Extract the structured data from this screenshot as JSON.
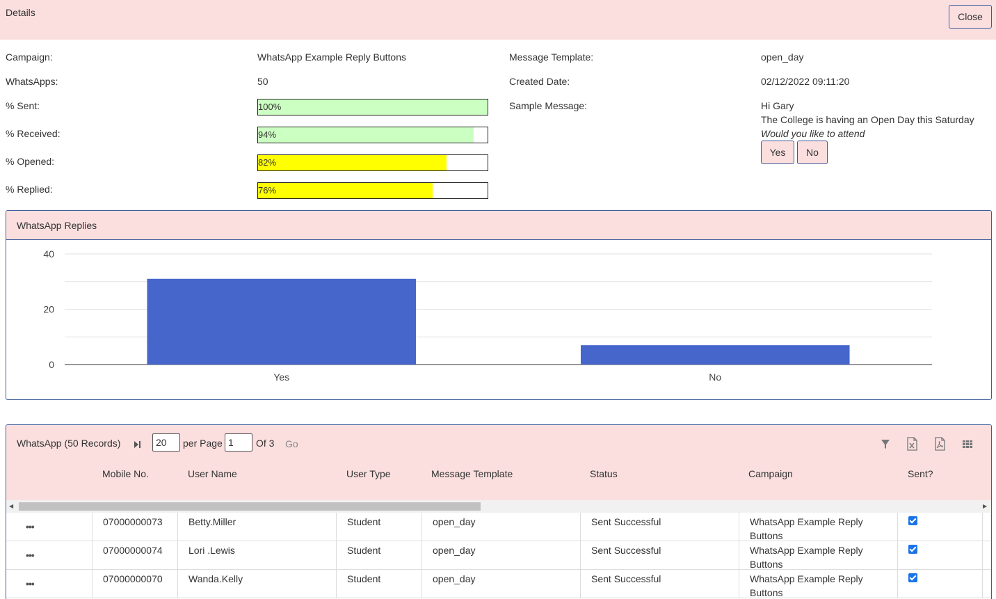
{
  "header": {
    "title": "Details",
    "close_label": "Close"
  },
  "details": {
    "campaign_label": "Campaign:",
    "campaign_value": "WhatsApp Example Reply Buttons",
    "whatsapps_label": "WhatsApps:",
    "whatsapps_value": "50",
    "template_label": "Message Template:",
    "template_value": "open_day",
    "created_label": "Created Date:",
    "created_value": "02/12/2022 09:11:20",
    "sample_label": "Sample Message:",
    "sample_lines": [
      "Hi Gary",
      "The College is having an Open Day this Saturday",
      "Would you like to attend"
    ],
    "sample_buttons": [
      "Yes",
      "No"
    ]
  },
  "progress": [
    {
      "label": "% Sent:",
      "text": "100%",
      "value": 100,
      "color": "#ccffc2"
    },
    {
      "label": "% Received:",
      "text": "94%",
      "value": 94,
      "color": "#ccffc2"
    },
    {
      "label": "% Opened:",
      "text": "82%",
      "value": 82,
      "color": "#ffff00"
    },
    {
      "label": "% Replied:",
      "text": "76%",
      "value": 76,
      "color": "#ffff00"
    }
  ],
  "replies_panel": {
    "title": "WhatsApp Replies"
  },
  "chart_data": {
    "type": "bar",
    "categories": [
      "Yes",
      "No"
    ],
    "values": [
      31,
      7
    ],
    "ylim": [
      0,
      40
    ],
    "yticks": [
      0,
      20,
      40
    ],
    "bar_color": "#4766cc",
    "grid": true
  },
  "grid": {
    "title": "WhatsApp (50 Records)",
    "per_page_value": "20",
    "per_page_label": "per Page",
    "page_value": "1",
    "of_label": "Of 3",
    "go_label": "Go",
    "columns": [
      "Mobile No.",
      "User Name",
      "User Type",
      "Message Template",
      "Status",
      "Campaign",
      "Sent?"
    ],
    "rows": [
      {
        "mobile": "07000000073",
        "user": "Betty.Miller",
        "type": "Student",
        "template": "open_day",
        "status": "Sent Successful",
        "campaign": "WhatsApp Example Reply Buttons",
        "sent": true
      },
      {
        "mobile": "07000000074",
        "user": "Lori .Lewis",
        "type": "Student",
        "template": "open_day",
        "status": "Sent Successful",
        "campaign": "WhatsApp Example Reply Buttons",
        "sent": true
      },
      {
        "mobile": "07000000070",
        "user": "Wanda.Kelly",
        "type": "Student",
        "template": "open_day",
        "status": "Sent Successful",
        "campaign": "WhatsApp Example Reply Buttons",
        "sent": true
      }
    ],
    "row_menu_glyph": "•••"
  }
}
